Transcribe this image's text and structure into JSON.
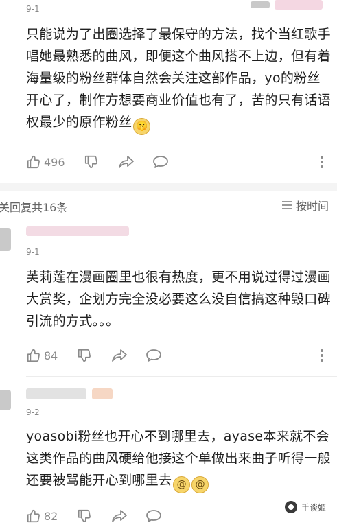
{
  "comments": [
    {
      "date": "9-1",
      "text": "只能说为了出圈选择了最保守的方法，找个当红歌手唱她最熟悉的曲风，即便这个曲风搭不上边，但有着海量级的粉丝群体自然会关注这部作品，yo的粉丝开心了，制作方想要商业价值也有了，苦的只有话语权最少的原作粉丝",
      "emojis": [
        "shh-emoji"
      ],
      "likes": "496"
    },
    {
      "date": "9-1",
      "text": "芙莉莲在漫画圈里也很有热度，更不用说过得过漫画大赏奖，企划方完全没必要这么没自信搞这种毁口碑引流的方式。。。",
      "emojis": [],
      "likes": "84"
    },
    {
      "date": "9-2",
      "text": "yoasobi粉丝也开心不到哪里去，ayase本来就不会这类作品的曲风硬给他接这个单做出来曲子听得一般还要被骂能开心到哪里去",
      "emojis": [
        "dizzy-emoji",
        "dizzy-emoji"
      ],
      "likes": "82"
    }
  ],
  "reply_bar": {
    "count_label": "关回复共16条",
    "sort_label": "按时间"
  },
  "watermark": {
    "label": "手谈姬"
  },
  "icons": {
    "like": "thumbs-up-icon",
    "dislike": "thumbs-down-icon",
    "share": "share-arrow-icon",
    "reply": "comment-bubble-icon",
    "more": "more-vertical-icon",
    "sort": "sort-lines-icon"
  },
  "colors": {
    "meta_gray": "#888888",
    "band_gray": "#f4f4f4",
    "emoji_yellow": "#f7d56a"
  }
}
